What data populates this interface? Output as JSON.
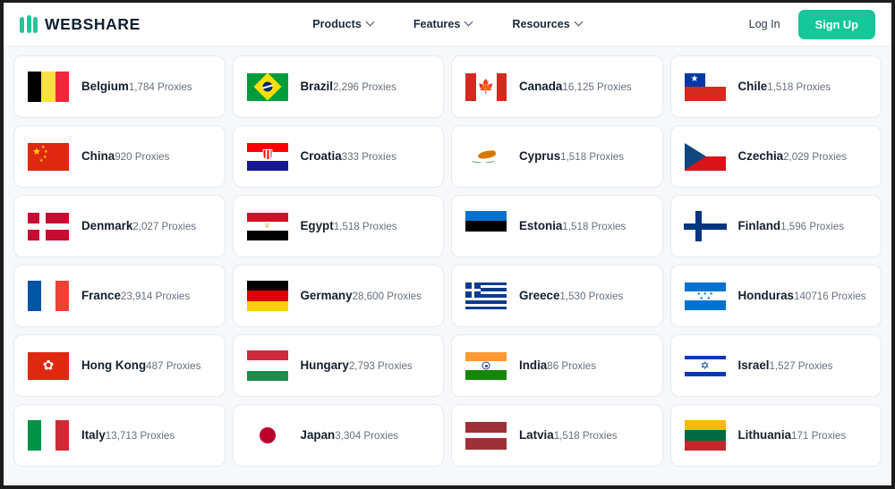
{
  "header": {
    "brand": "WEBSHARE",
    "nav": [
      {
        "label": "Products"
      },
      {
        "label": "Features"
      },
      {
        "label": "Resources"
      }
    ],
    "login_label": "Log In",
    "signup_label": "Sign Up",
    "accent_color": "#16c79a",
    "brand_color": "#0f1f33"
  },
  "countries": [
    {
      "name": "Belgium",
      "count": "1,784 Proxies",
      "flag": "belgium"
    },
    {
      "name": "Brazil",
      "count": "2,296 Proxies",
      "flag": "brazil"
    },
    {
      "name": "Canada",
      "count": "16,125 Proxies",
      "flag": "canada"
    },
    {
      "name": "Chile",
      "count": "1,518 Proxies",
      "flag": "chile"
    },
    {
      "name": "China",
      "count": "920 Proxies",
      "flag": "china"
    },
    {
      "name": "Croatia",
      "count": "333 Proxies",
      "flag": "croatia"
    },
    {
      "name": "Cyprus",
      "count": "1,518 Proxies",
      "flag": "cyprus"
    },
    {
      "name": "Czechia",
      "count": "2,029 Proxies",
      "flag": "czechia"
    },
    {
      "name": "Denmark",
      "count": "2,027 Proxies",
      "flag": "denmark"
    },
    {
      "name": "Egypt",
      "count": "1,518 Proxies",
      "flag": "egypt"
    },
    {
      "name": "Estonia",
      "count": "1,518 Proxies",
      "flag": "estonia"
    },
    {
      "name": "Finland",
      "count": "1,596 Proxies",
      "flag": "finland"
    },
    {
      "name": "France",
      "count": "23,914 Proxies",
      "flag": "france"
    },
    {
      "name": "Germany",
      "count": "28,600 Proxies",
      "flag": "germany"
    },
    {
      "name": "Greece",
      "count": "1,530 Proxies",
      "flag": "greece"
    },
    {
      "name": "Honduras",
      "count": "140716 Proxies",
      "flag": "honduras"
    },
    {
      "name": "Hong Kong",
      "count": "487 Proxies",
      "flag": "hongkong"
    },
    {
      "name": "Hungary",
      "count": "2,793 Proxies",
      "flag": "hungary"
    },
    {
      "name": "India",
      "count": "86 Proxies",
      "flag": "india"
    },
    {
      "name": "Israel",
      "count": "1,527 Proxies",
      "flag": "israel"
    },
    {
      "name": "Italy",
      "count": "13,713 Proxies",
      "flag": "italy"
    },
    {
      "name": "Japan",
      "count": "3,304 Proxies",
      "flag": "japan"
    },
    {
      "name": "Latvia",
      "count": "1,518 Proxies",
      "flag": "latvia"
    },
    {
      "name": "Lithuania",
      "count": "171 Proxies",
      "flag": "lithuania"
    }
  ]
}
